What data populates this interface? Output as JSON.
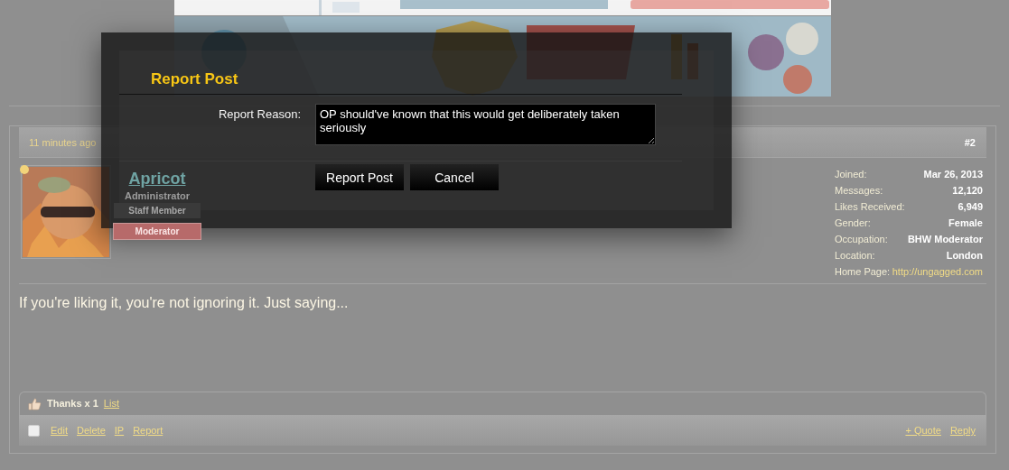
{
  "post": {
    "time": "11 minutes ago",
    "number": "#2",
    "user": {
      "name": "Apricot",
      "title": "Administrator",
      "online": true,
      "banners": [
        {
          "label": "Staff Member",
          "kind": "staff"
        },
        {
          "label": "Moderator",
          "kind": "moderator"
        }
      ]
    },
    "stats": [
      {
        "label": "Joined:",
        "value": "Mar 26, 2013",
        "kind": "text"
      },
      {
        "label": "Messages:",
        "value": "12,120",
        "kind": "text"
      },
      {
        "label": "Likes Received:",
        "value": "6,949",
        "kind": "text"
      },
      {
        "label": "Gender:",
        "value": "Female",
        "kind": "text"
      },
      {
        "label": "Occupation:",
        "value": "BHW Moderator",
        "kind": "text"
      },
      {
        "label": "Location:",
        "value": "London",
        "kind": "text"
      },
      {
        "label": "Home Page:",
        "value": "http://ungagged.com",
        "kind": "link"
      }
    ],
    "message": "If you're liking it, you're not ignoring it. Just saying...",
    "likes": {
      "text": "Thanks x 1",
      "link": "List"
    },
    "select_checked": false,
    "actions_left": [
      "Edit",
      "Delete",
      "IP",
      "Report"
    ],
    "actions_right": [
      "+ Quote",
      "Reply"
    ]
  },
  "dialog": {
    "title": "Report Post",
    "field_label": "Report Reason:",
    "field_value": "OP should've known that this would get deliberately taken seriously",
    "buttons": [
      "Report Post",
      "Cancel"
    ]
  }
}
